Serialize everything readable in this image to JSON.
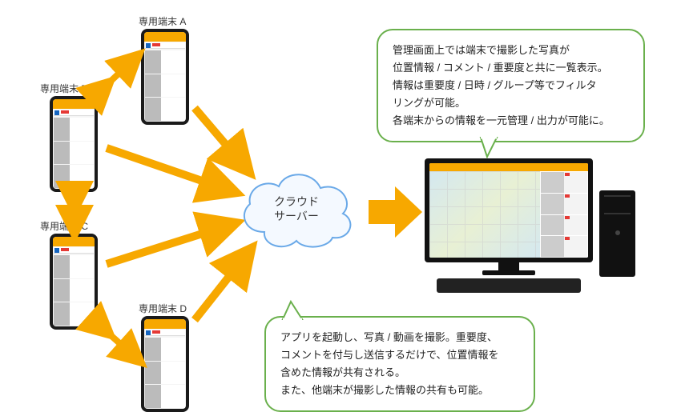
{
  "devices": {
    "a": {
      "label": "専用端末 A"
    },
    "b": {
      "label": "専用端末 B"
    },
    "c": {
      "label": "専用端末 C"
    },
    "d": {
      "label": "専用端末 D"
    }
  },
  "cloud": {
    "line1": "クラウド",
    "line2": "サーバー"
  },
  "callout_top": {
    "l1": "管理画面上では端末で撮影した写真が",
    "l2": "位置情報 / コメント / 重要度と共に一覧表示。",
    "l3": "情報は重要度 / 日時 / グループ等でフィルタ",
    "l4": "リングが可能。",
    "l5": "各端末からの情報を一元管理 / 出力が可能に。"
  },
  "callout_bottom": {
    "l1": "アプリを起動し、写真 / 動画を撮影。重要度、",
    "l2": "コメントを付与し送信するだけで、位置情報を",
    "l3": "含めた情報が共有される。",
    "l4": "また、他端末が撮影した情報の共有も可能。"
  },
  "colors": {
    "arrow": "#f7a800",
    "callout_border": "#6ab04c",
    "cloud_stroke": "#6aa9e8"
  }
}
